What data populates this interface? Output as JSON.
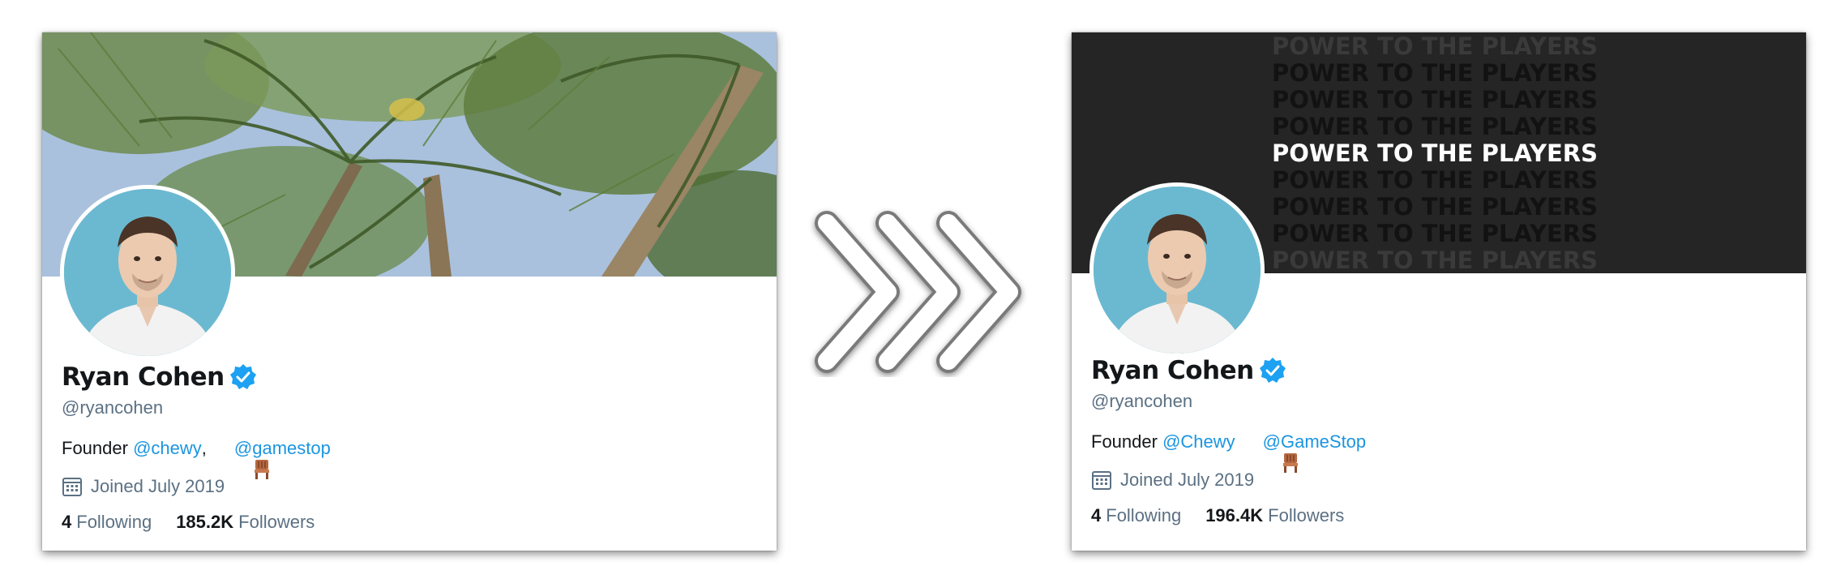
{
  "before": {
    "name": "Ryan Cohen",
    "handle": "@ryancohen",
    "bio": {
      "prefix": "Founder ",
      "link1": "@chewy",
      "separator": ",",
      "link2": "@gamestop"
    },
    "joined": "Joined July 2019",
    "following_count": "4",
    "following_label": "Following",
    "followers_count": "185.2K",
    "followers_label": "Followers"
  },
  "after": {
    "name": "Ryan Cohen",
    "handle": "@ryancohen",
    "bio": {
      "prefix": "Founder ",
      "link1": "@Chewy",
      "separator": "",
      "link2": "@GameStop"
    },
    "banner_text": "POWER TO THE PLAYERS",
    "joined": "Joined July 2019",
    "following_count": "4",
    "following_label": "Following",
    "followers_count": "196.4K",
    "followers_label": "Followers"
  },
  "colors": {
    "link": "#1b95e0",
    "verified": "#1da1f2",
    "muted_text": "#5b7083",
    "text": "#14171a",
    "dark_banner": "#252525"
  },
  "icons": [
    "verified-badge-icon",
    "calendar-icon",
    "chair-emoji-icon",
    "chevron-arrow-icon"
  ]
}
